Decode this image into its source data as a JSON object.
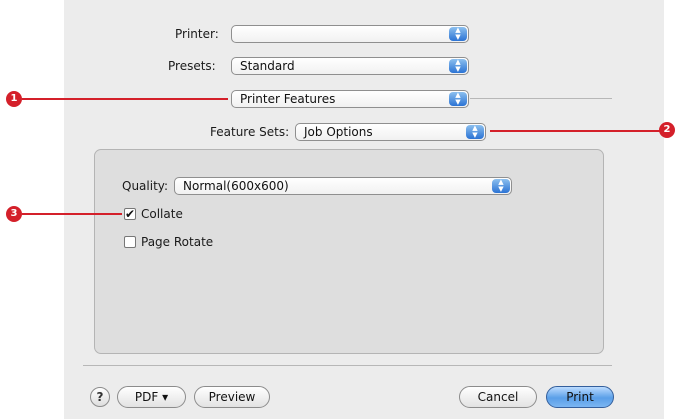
{
  "dialog": {
    "printer": {
      "label": "Printer:",
      "value": ""
    },
    "presets": {
      "label": "Presets:",
      "value": "Standard"
    },
    "panel": {
      "value": "Printer Features"
    },
    "feature_sets": {
      "label": "Feature Sets:",
      "value": "Job Options"
    },
    "quality": {
      "label": "Quality:",
      "value": "Normal(600x600)"
    },
    "collate": {
      "label": "Collate",
      "checked": true
    },
    "page_rotate": {
      "label": "Page Rotate",
      "checked": false
    }
  },
  "footer": {
    "help_label": "?",
    "pdf_label": "PDF ▾",
    "preview_label": "Preview",
    "cancel_label": "Cancel",
    "print_label": "Print"
  },
  "callouts": [
    "1",
    "2",
    "3"
  ],
  "colors": {
    "callout": "#d4202a",
    "accent": "#5a9fe8",
    "dialog_bg": "#ececec"
  },
  "icons": {
    "popup": "updown-arrows-icon",
    "checkbox": "checkmark-icon",
    "help": "help-icon"
  }
}
